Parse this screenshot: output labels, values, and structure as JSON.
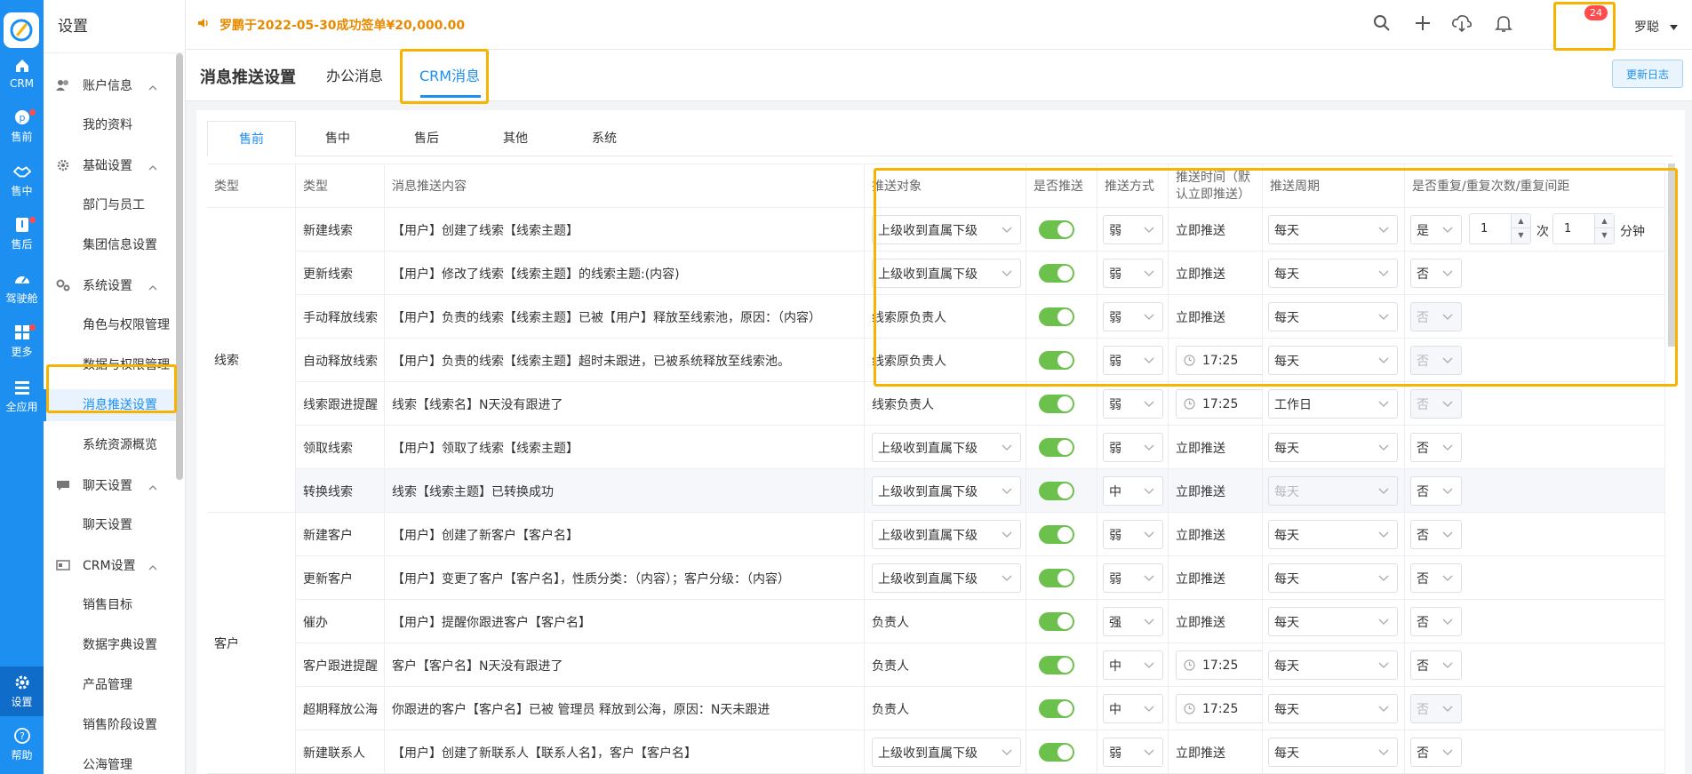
{
  "rail": {
    "items": [
      {
        "label": "CRM",
        "icon": "home-icon"
      },
      {
        "label": "售前",
        "icon": "pinterest-icon"
      },
      {
        "label": "售中",
        "icon": "handshake-icon"
      },
      {
        "label": "售后",
        "icon": "badge-icon"
      },
      {
        "label": "驾驶舱",
        "icon": "dashboard-icon"
      },
      {
        "label": "更多",
        "icon": "grid-icon"
      },
      {
        "label": "全应用",
        "icon": "menu-icon"
      },
      {
        "label": "设置",
        "icon": "gear-icon"
      },
      {
        "label": "帮助",
        "icon": "help-icon"
      }
    ]
  },
  "sidebar": {
    "title": "设置",
    "groups": [
      {
        "label": "账户信息",
        "items": [
          "我的资料"
        ]
      },
      {
        "label": "基础设置",
        "items": [
          "部门与员工",
          "集团信息设置"
        ]
      },
      {
        "label": "系统设置",
        "items": [
          "角色与权限管理",
          "数据与权限管理",
          "消息推送设置",
          "系统资源概览"
        ]
      },
      {
        "label": "聊天设置",
        "items": [
          "聊天设置"
        ]
      },
      {
        "label": "CRM设置",
        "items": [
          "销售目标",
          "数据字典设置",
          "产品管理",
          "销售阶段设置",
          "公海管理"
        ]
      }
    ],
    "active_item": "消息推送设置"
  },
  "header": {
    "notice": "罗鹏于2022-05-30成功签单¥20,000.00",
    "badge_count": "24",
    "user": "罗聪"
  },
  "page": {
    "title": "消息推送设置",
    "tabs": [
      "办公消息",
      "CRM消息"
    ],
    "active_tab": "CRM消息",
    "update_log": "更新日志"
  },
  "subtabs": [
    "售前",
    "售中",
    "售后",
    "其他",
    "系统"
  ],
  "table": {
    "headers": {
      "category": "类型",
      "type": "类型",
      "content": "消息推送内容",
      "target": "推送对象",
      "enabled": "是否推送",
      "method": "推送方式",
      "time": "推送时间（默认立即推送）",
      "cycle": "推送周期",
      "repeat": "是否重复/重复次数/重复间距"
    },
    "groups": [
      {
        "name": "线索",
        "rows": 7
      },
      {
        "name": "客户",
        "rows": 6
      }
    ],
    "rows": [
      {
        "type": "新建线索",
        "content": "【用户】创建了线索【线索主题】",
        "target": "上级收到直属下级",
        "target_select": true,
        "method": "弱",
        "time": "立即推送",
        "time_picker": false,
        "cycle": "每天",
        "cycle_disabled": false,
        "repeat": "是",
        "repeat_disabled": false,
        "repeat_count": "1",
        "count_unit": "次",
        "repeat_interval": "1",
        "interval_unit": "分钟"
      },
      {
        "type": "更新线索",
        "content": "【用户】修改了线索【线索主题】的线索主题:(内容)",
        "target": "上级收到直属下级",
        "target_select": true,
        "method": "弱",
        "time": "立即推送",
        "time_picker": false,
        "cycle": "每天",
        "cycle_disabled": false,
        "repeat": "否",
        "repeat_disabled": false
      },
      {
        "type": "手动释放线索",
        "content": "【用户】负责的线索【线索主题】已被【用户】释放至线索池，原因：（内容）",
        "target": "线索原负责人",
        "target_select": false,
        "method": "弱",
        "time": "立即推送",
        "time_picker": false,
        "cycle": "每天",
        "cycle_disabled": false,
        "repeat": "否",
        "repeat_disabled": true
      },
      {
        "type": "自动释放线索",
        "content": "【用户】负责的线索【线索主题】超时未跟进，已被系统释放至线索池。",
        "target": "线索原负责人",
        "target_select": false,
        "method": "弱",
        "time": "17:25",
        "time_picker": true,
        "cycle": "每天",
        "cycle_disabled": false,
        "repeat": "否",
        "repeat_disabled": true
      },
      {
        "type": "线索跟进提醒",
        "content": "线索【线索名】N天没有跟进了",
        "target": "线索负责人",
        "target_select": false,
        "method": "弱",
        "time": "17:25",
        "time_picker": true,
        "cycle": "工作日",
        "cycle_disabled": false,
        "repeat": "否",
        "repeat_disabled": true
      },
      {
        "type": "领取线索",
        "content": "【用户】领取了线索【线索主题】",
        "target": "上级收到直属下级",
        "target_select": true,
        "method": "弱",
        "time": "立即推送",
        "time_picker": false,
        "cycle": "每天",
        "cycle_disabled": false,
        "repeat": "否",
        "repeat_disabled": false
      },
      {
        "type": "转换线索",
        "content": "线索【线索主题】已转换成功",
        "target": "上级收到直属下级",
        "target_select": true,
        "method": "中",
        "time": "立即推送",
        "time_picker": false,
        "cycle": "每天",
        "cycle_disabled": true,
        "repeat": "否",
        "repeat_disabled": false
      },
      {
        "type": "新建客户",
        "content": "【用户】创建了新客户【客户名】",
        "target": "上级收到直属下级",
        "target_select": true,
        "method": "弱",
        "time": "立即推送",
        "time_picker": false,
        "cycle": "每天",
        "cycle_disabled": false,
        "repeat": "否",
        "repeat_disabled": false
      },
      {
        "type": "更新客户",
        "content": "【用户】变更了客户【客户名】，性质分类：（内容）；客户分级：（内容）",
        "target": "上级收到直属下级",
        "target_select": true,
        "method": "弱",
        "time": "立即推送",
        "time_picker": false,
        "cycle": "每天",
        "cycle_disabled": false,
        "repeat": "否",
        "repeat_disabled": false
      },
      {
        "type": "催办",
        "content": "【用户】提醒你跟进客户【客户名】",
        "target": "负责人",
        "target_select": false,
        "method": "强",
        "time": "立即推送",
        "time_picker": false,
        "cycle": "每天",
        "cycle_disabled": false,
        "repeat": "否",
        "repeat_disabled": false
      },
      {
        "type": "客户跟进提醒",
        "content": "客户【客户名】N天没有跟进了",
        "target": "负责人",
        "target_select": false,
        "method": "中",
        "time": "17:25",
        "time_picker": true,
        "cycle": "每天",
        "cycle_disabled": false,
        "repeat": "否",
        "repeat_disabled": false
      },
      {
        "type": "超期释放公海",
        "content": "你跟进的客户【客户名】已被 管理员 释放到公海，原因：N天未跟进",
        "target": "负责人",
        "target_select": false,
        "method": "中",
        "time": "17:25",
        "time_picker": true,
        "cycle": "每天",
        "cycle_disabled": false,
        "repeat": "否",
        "repeat_disabled": true
      },
      {
        "type": "新建联系人",
        "content": "【用户】创建了新联系人【联系人名】，客户【客户名】",
        "target": "上级收到直属下级",
        "target_select": true,
        "method": "弱",
        "time": "立即推送",
        "time_picker": false,
        "cycle": "每天",
        "cycle_disabled": false,
        "repeat": "否",
        "repeat_disabled": false
      }
    ]
  },
  "colors": {
    "primary": "#1d8ff0",
    "toggle_on": "#6cc14d",
    "highlight": "#f6b300",
    "notice": "#e88a00",
    "badge": "#ff4d4f"
  }
}
